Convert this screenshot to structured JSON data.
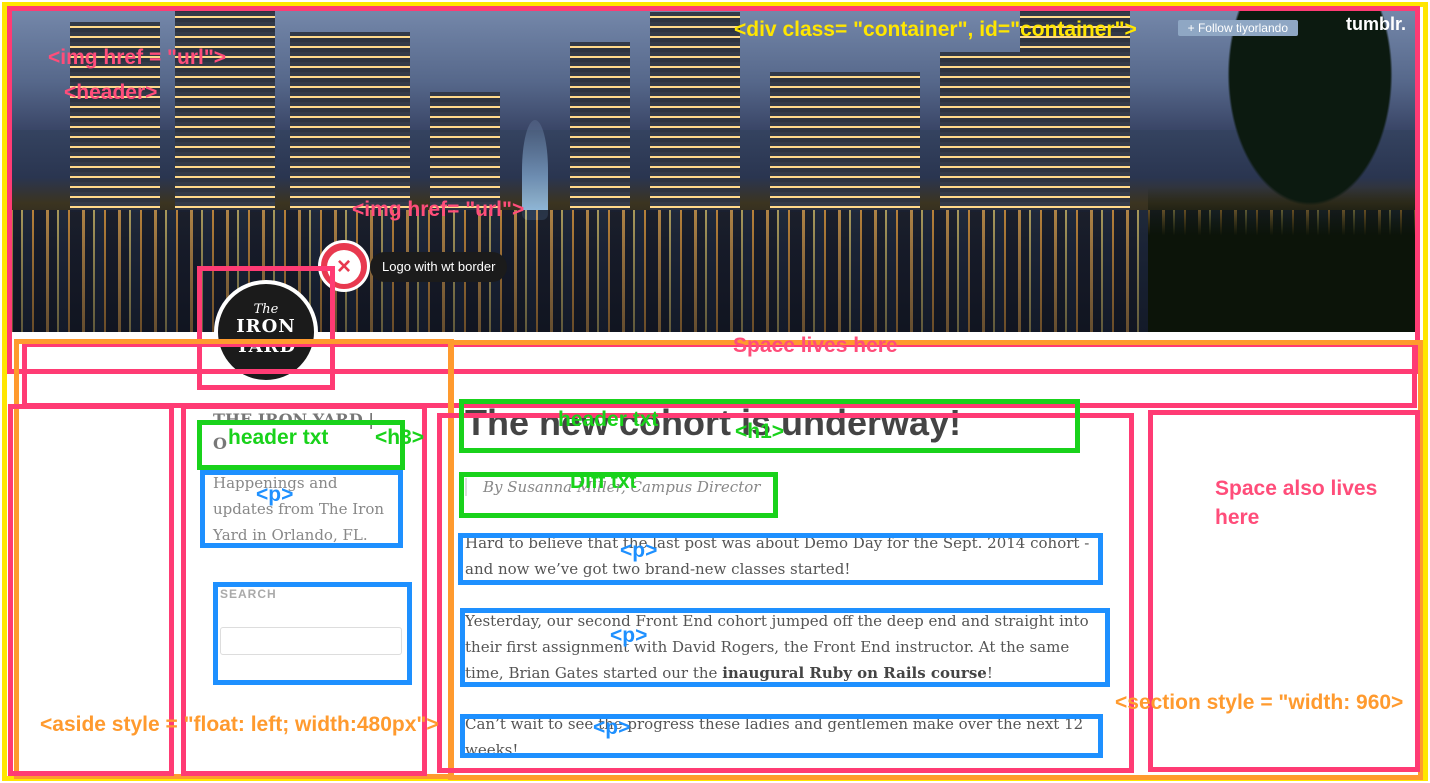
{
  "header": {
    "follow_label": "+ Follow tiyorlando",
    "tumblr_label": "tumblr."
  },
  "logo": {
    "line1": "The",
    "line2": "IRON",
    "line3": "YARD",
    "tooltip_close": "×",
    "tooltip_label": "Logo with wt border"
  },
  "sidebar": {
    "title_line1": "THE IRON YARD |",
    "title_line2": "O",
    "description": "Happenings and updates from The Iron Yard in Orlando, FL.",
    "search_label": "SEARCH",
    "search_value": ""
  },
  "post": {
    "title": "The new cohort is underway!",
    "byline": "By Susanna Miller, Campus Director",
    "p1": "Hard to believe that the last post was about Demo Day for the Sept. 2014 cohort - and now we’ve got two brand-new classes started!",
    "p2_start": "Yesterday, our second Front End cohort jumped off the deep end and straight into their first assignment with David Rogers, the Front End instructor. At the same time, Brian Gates started our the ",
    "p2_bold": "inaugural Ruby on Rails course",
    "p2_end": "!",
    "p3": "Can’t wait to see the progress these ladies and gentlemen make over the next 12 weeks!"
  },
  "annotations": {
    "container": "<div class= \"container\", id=\"container\">",
    "img_top": "<img href = \"url\">",
    "header": "<header>",
    "img_mid": "<img href= \"url\">",
    "space_lives": "Space lives here",
    "space_also": "Space also lives here",
    "header_txt_h3": "header txt",
    "h3": "<h3>",
    "header_txt_h1": "header txt",
    "h1": "<h1>",
    "diff_txt": "Diff txt",
    "p": "<p>",
    "aside": "<aside style = \"float: left; width:480px\">",
    "section": "<section style = \"width: 960>"
  }
}
